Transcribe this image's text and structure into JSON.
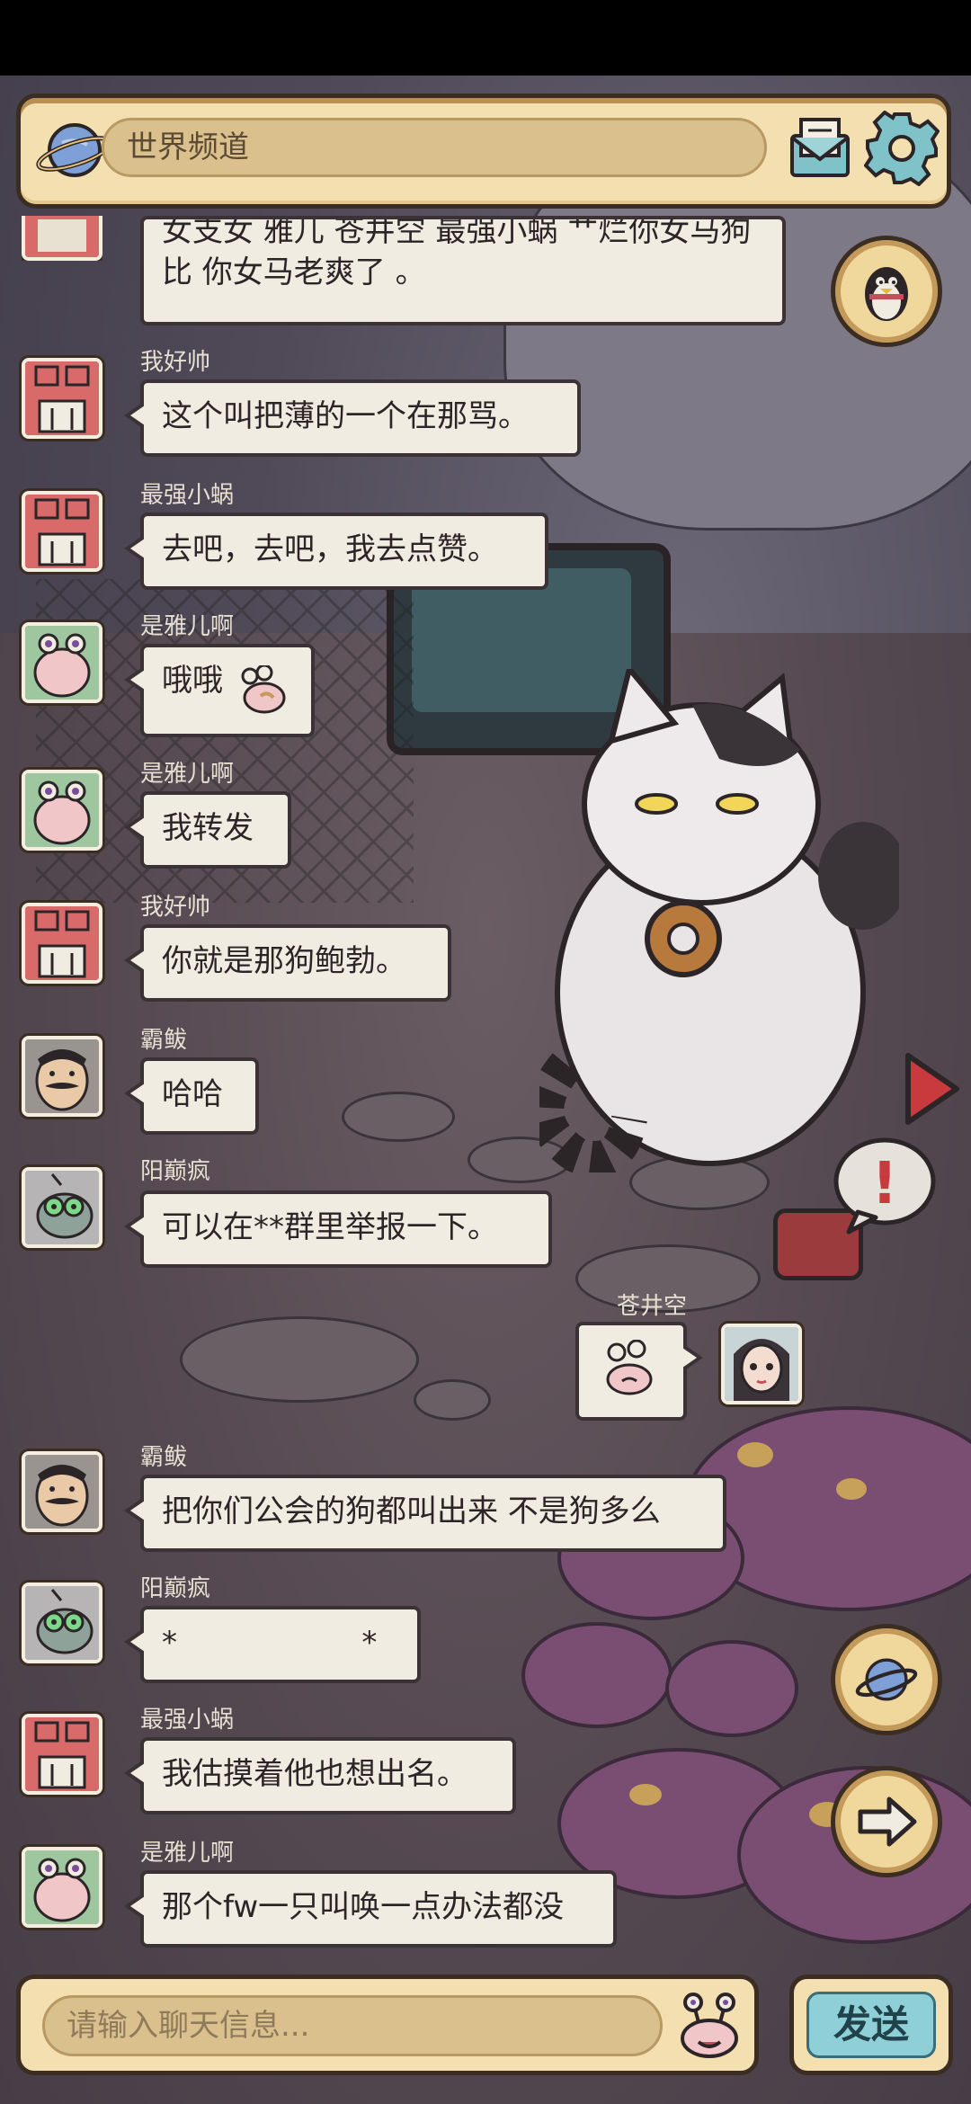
{
  "header": {
    "channel_title": "世界频道",
    "planet_icon": "planet-icon",
    "mail_icon": "mail-icon",
    "settings_icon": "gear-icon"
  },
  "colors": {
    "bubble": "#f1ece1",
    "panel": "#f3dfb0",
    "send": "#8fd0d8",
    "status_bar": "#000000"
  },
  "messages": [
    {
      "user": "",
      "avatar": "red-snail",
      "text": "女支女 雅儿 苍井空 最强小蜗 艹烂你女马狗比 你女马老爽了 。"
    },
    {
      "user": "我好帅",
      "avatar": "red-snail",
      "text": "这个叫把薄的一个在那骂。"
    },
    {
      "user": "最强小蜗",
      "avatar": "red-snail",
      "text": "去吧，去吧，我去点赞。"
    },
    {
      "user": "是雅儿啊",
      "avatar": "pink-snail",
      "text": "哦哦"
    },
    {
      "user": "是雅儿啊",
      "avatar": "pink-snail",
      "text": "我转发"
    },
    {
      "user": "我好帅",
      "avatar": "red-snail",
      "text": "你就是那狗鲍勃。"
    },
    {
      "user": "霸鲅",
      "avatar": "mustache-man",
      "text": "哈哈"
    },
    {
      "user": "阳巅疯",
      "avatar": "green-robot",
      "text": "可以在**群里举报一下。"
    },
    {
      "user": "苍井空",
      "avatar": "girl",
      "text": ""
    },
    {
      "user": "霸鲅",
      "avatar": "mustache-man",
      "text": "把你们公会的狗都叫出来 不是狗多么"
    },
    {
      "user": "阳巅疯",
      "avatar": "green-robot",
      "text": "*                   *"
    },
    {
      "user": "最强小蜗",
      "avatar": "red-snail",
      "text": "我估摸着他也想出名。"
    },
    {
      "user": "是雅儿啊",
      "avatar": "pink-snail",
      "text": "那个fw一只叫唤一点办法都没"
    }
  ],
  "side_buttons": {
    "qq": "penguin-icon",
    "planet": "planet-icon",
    "next": "arrow-right-icon",
    "alert": "!"
  },
  "input": {
    "placeholder": "请输入聊天信息..."
  },
  "send_label": "发送"
}
